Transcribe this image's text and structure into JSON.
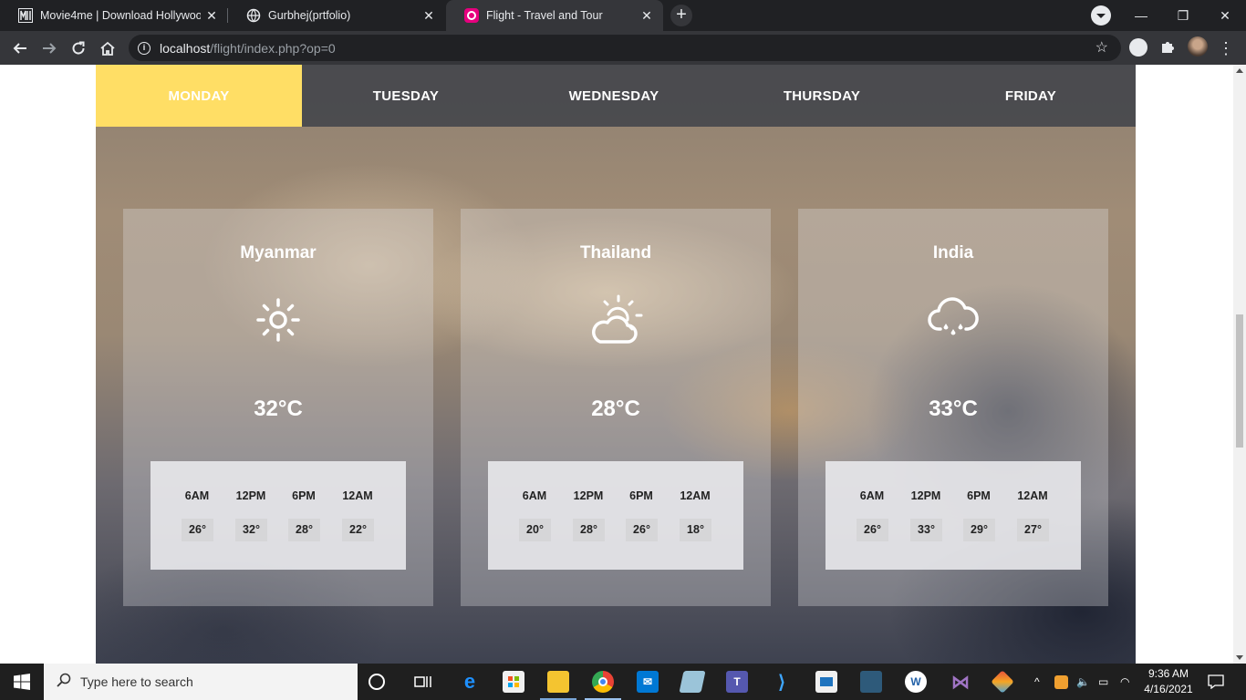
{
  "browser": {
    "tabs": [
      {
        "title": "Movie4me | Download Hollywoo",
        "favicon": "movie4me-icon",
        "active": false
      },
      {
        "title": "Gurbhej(prtfolio)",
        "favicon": "globe-icon",
        "active": false
      },
      {
        "title": "Flight - Travel and Tour",
        "favicon": "flight-site-icon",
        "active": true
      }
    ],
    "url_host": "localhost",
    "url_path": "/flight/index.php?op=0"
  },
  "weather": {
    "days": [
      "MONDAY",
      "TUESDAY",
      "WEDNESDAY",
      "THURSDAY",
      "FRIDAY"
    ],
    "active_day": "MONDAY",
    "accent_color": "#ffde65",
    "cards": [
      {
        "city": "Myanmar",
        "icon": "sun-icon",
        "temp": "32°C",
        "hours": [
          "6AM",
          "12PM",
          "6PM",
          "12AM"
        ],
        "values": [
          "26°",
          "32°",
          "28°",
          "22°"
        ]
      },
      {
        "city": "Thailand",
        "icon": "partly-cloudy-icon",
        "temp": "28°C",
        "hours": [
          "6AM",
          "12PM",
          "6PM",
          "12AM"
        ],
        "values": [
          "20°",
          "28°",
          "26°",
          "18°"
        ]
      },
      {
        "city": "India",
        "icon": "rain-cloud-icon",
        "temp": "33°C",
        "hours": [
          "6AM",
          "12PM",
          "6PM",
          "12AM"
        ],
        "values": [
          "26°",
          "33°",
          "29°",
          "27°"
        ]
      }
    ]
  },
  "taskbar": {
    "search_placeholder": "Type here to search",
    "time": "9:36 AM",
    "date": "4/16/2021"
  }
}
